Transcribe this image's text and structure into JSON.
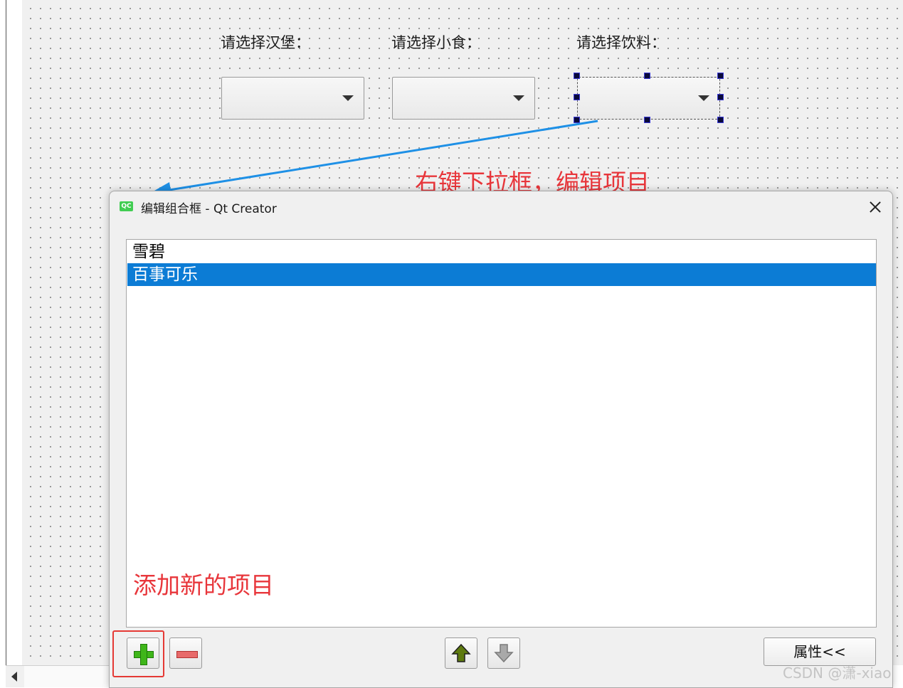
{
  "designer": {
    "labels": [
      "请选择汉堡：",
      "请选择小食：",
      "请选择饮料："
    ]
  },
  "annotations": {
    "right_click": "右键下拉框，编辑项目",
    "add_new": "添加新的项目"
  },
  "dialog": {
    "logo_text": "QC",
    "title": "编辑组合框 - Qt Creator",
    "items": [
      "雪碧",
      "百事可乐"
    ],
    "selected_index": 1,
    "properties_button": "属性<<"
  },
  "watermark": "CSDN @潇-xiao",
  "colors": {
    "annotation": "#e8363b",
    "selection": "#0c7cd5",
    "arrow": "#1e90e6"
  },
  "icons": [
    "plus-icon",
    "minus-icon",
    "move-up-icon",
    "move-down-icon",
    "close-icon",
    "qt-logo-icon",
    "scroll-left-arrow-icon"
  ]
}
